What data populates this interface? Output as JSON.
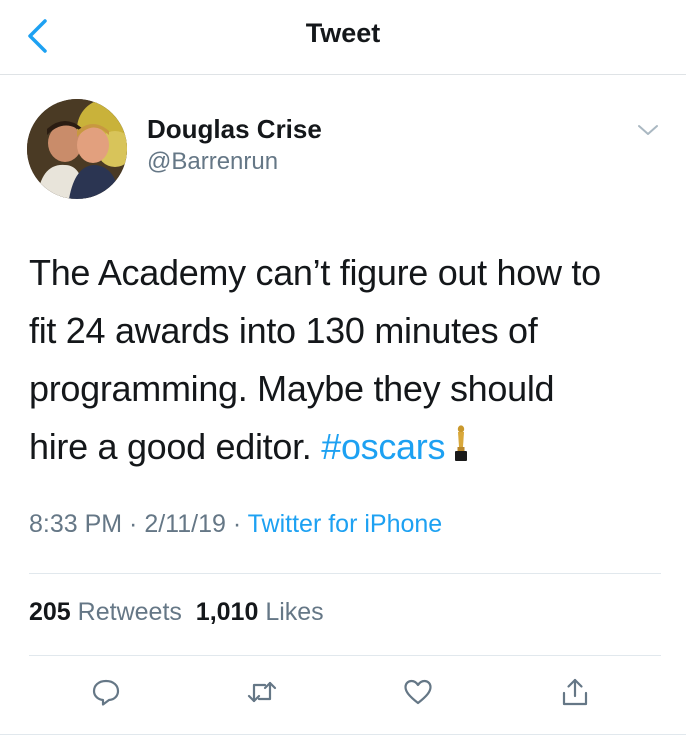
{
  "header": {
    "title": "Tweet",
    "back_icon": "chevron-left-icon"
  },
  "author": {
    "name": "Douglas Crise",
    "handle": "@Barrenrun"
  },
  "tweet": {
    "text_line1": "The Academy can’t figure out how to",
    "text_line2": "fit 24 awards into 130 minutes of",
    "text_line3": "programming. Maybe they should",
    "text_line4_prefix": "hire a good editor. ",
    "hashtag": "#oscars",
    "emoji": "oscar-trophy-icon"
  },
  "meta": {
    "time": "8:33 PM",
    "separator1": " · ",
    "date": "2/11/19",
    "separator2": " · ",
    "source": "Twitter for iPhone"
  },
  "stats": {
    "retweets_count": "205",
    "retweets_label": "Retweets",
    "likes_count": "1,010",
    "likes_label": "Likes"
  },
  "actions": {
    "reply_icon": "reply-icon",
    "retweet_icon": "retweet-icon",
    "like_icon": "heart-icon",
    "share_icon": "share-icon"
  },
  "colors": {
    "accent": "#1da1f2",
    "text_primary": "#14171a",
    "text_secondary": "#657786",
    "divider": "#e1e8ed"
  }
}
